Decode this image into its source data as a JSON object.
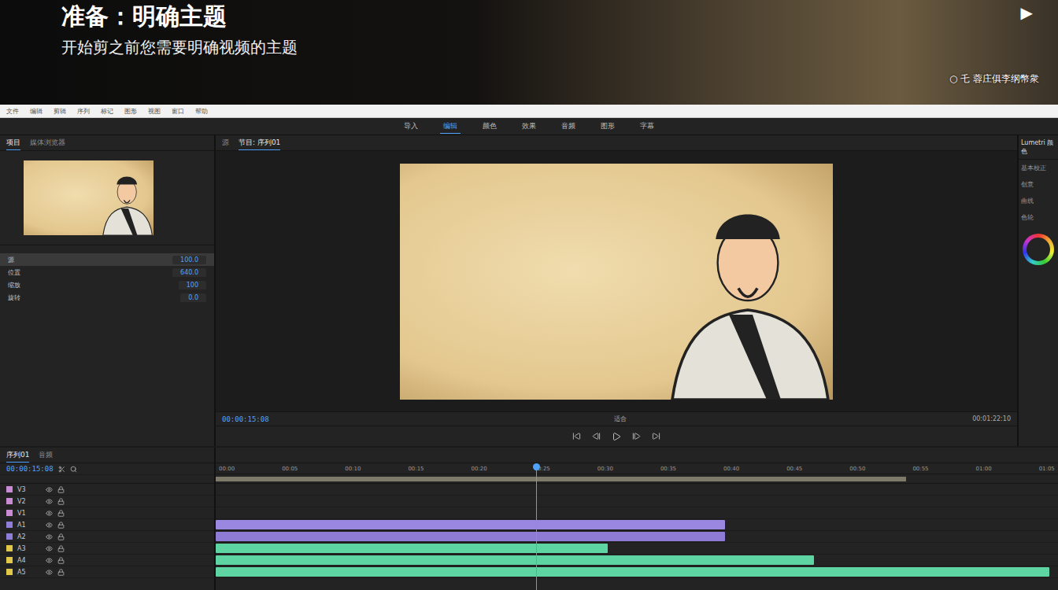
{
  "banner": {
    "title": "准备：明确主题",
    "subtitle": "开始剪之前您需要明确视频的主题",
    "caption": "○ 乇 蓉庄俱李纲幣衆",
    "play": "▶"
  },
  "menu": [
    "文件",
    "编辑",
    "剪辑",
    "序列",
    "标记",
    "图形",
    "视图",
    "窗口",
    "帮助"
  ],
  "toolbar": [
    {
      "label": "导入",
      "selected": false
    },
    {
      "label": "编辑",
      "selected": true
    },
    {
      "label": "颜色",
      "selected": false
    },
    {
      "label": "效果",
      "selected": false
    },
    {
      "label": "音频",
      "selected": false
    },
    {
      "label": "图形",
      "selected": false
    },
    {
      "label": "字幕",
      "selected": false
    }
  ],
  "project": {
    "tabs": [
      {
        "label": "项目",
        "selected": true
      },
      {
        "label": "媒体浏览器",
        "selected": false
      }
    ],
    "properties": [
      {
        "label": "源",
        "value": "100.0",
        "selected": true
      },
      {
        "label": "位置",
        "value": "640.0",
        "selected": false
      },
      {
        "label": "缩放",
        "value": "100",
        "selected": false
      },
      {
        "label": "旋转",
        "value": "0.0",
        "selected": false
      }
    ]
  },
  "viewer": {
    "tabs": [
      {
        "label": "源",
        "selected": false
      },
      {
        "label": "节目: 序列01",
        "selected": true
      }
    ],
    "timecode": "00:00:15:08",
    "fit": "适合",
    "duration": "00:01:22:10"
  },
  "right_panel": {
    "title": "Lumetri 颜色",
    "items": [
      "基本校正",
      "创意",
      "曲线",
      "色轮"
    ]
  },
  "timeline": {
    "tabs": [
      {
        "label": "序列01",
        "selected": true
      },
      {
        "label": "音频",
        "selected": false
      }
    ],
    "timecode": "00:00:15:08",
    "ticks": [
      "00:00",
      "00:05",
      "00:10",
      "00:15",
      "00:20",
      "00:25",
      "00:30",
      "00:35",
      "00:40",
      "00:45",
      "00:50",
      "00:55",
      "01:00",
      "01:05"
    ],
    "playhead": 0.38,
    "work_area": {
      "start": 0,
      "length": 0.82
    },
    "tracks": [
      {
        "name": "V3",
        "color": "#c98bd4",
        "clips": []
      },
      {
        "name": "V2",
        "color": "#c98bd4",
        "clips": []
      },
      {
        "name": "V1",
        "color": "#c98bd4",
        "clips": []
      },
      {
        "name": "A1",
        "color": "#8f7ed8",
        "clips": [
          {
            "start": 0,
            "length": 0.605,
            "color": "#9a88e0"
          }
        ]
      },
      {
        "name": "A2",
        "color": "#8f7ed8",
        "clips": [
          {
            "start": 0,
            "length": 0.605,
            "color": "#8e7bd6"
          }
        ]
      },
      {
        "name": "A3",
        "color": "#e0c84a",
        "clips": [
          {
            "start": 0,
            "length": 0.465,
            "color": "#5fd4a3"
          }
        ]
      },
      {
        "name": "A4",
        "color": "#e0c84a",
        "clips": [
          {
            "start": 0,
            "length": 0.71,
            "color": "#5fd4a3"
          }
        ]
      },
      {
        "name": "A5",
        "color": "#e0c84a",
        "clips": [
          {
            "start": 0,
            "length": 0.99,
            "color": "#5fd4a3"
          }
        ]
      }
    ]
  }
}
